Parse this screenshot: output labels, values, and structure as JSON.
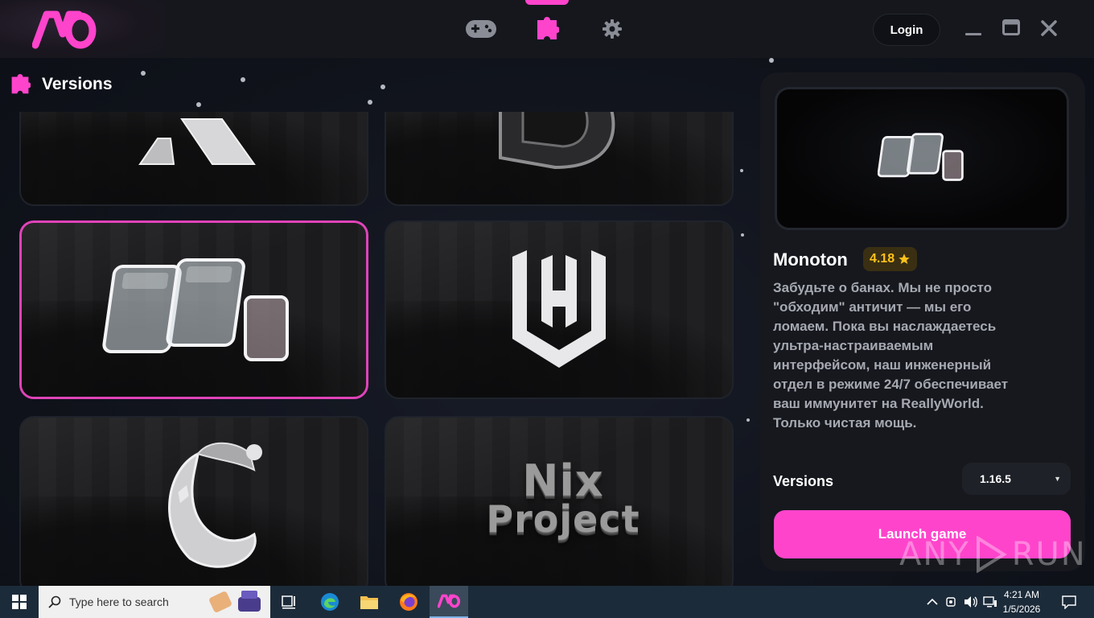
{
  "app": {
    "nav": {
      "games_icon": "gamepad-icon",
      "versions_icon": "puzzle-icon",
      "settings_icon": "gear-icon"
    },
    "login_label": "Login",
    "accent_color": "#ff44cc",
    "section_title": "Versions"
  },
  "cards": [
    {
      "name": "card-partial-left-logo"
    },
    {
      "name": "card-partial-right-logo"
    },
    {
      "name": "card-monoton",
      "selected": true
    },
    {
      "name": "card-lw-logo"
    },
    {
      "name": "card-moon-logo"
    },
    {
      "name": "card-nix-project",
      "logo_line1": "Nix",
      "logo_line2": "Project"
    }
  ],
  "details": {
    "name": "Monoton",
    "rating": "4.18",
    "description": "Забудьте о банах. Мы не просто \"обходим\" античит — мы его ломаем. Пока вы наслаждаетесь ультра-настраиваемым интерфейсом, наш инженерный отдел в режиме 24/7 обеспечивает ваш иммунитет на ReallyWorld. Только чистая мощь.",
    "versions_label": "Versions",
    "selected_version": "1.16.5",
    "launch_label": "Launch game",
    "rating_color": "#ffc21a"
  },
  "watermark": {
    "text_left": "ANY",
    "text_right": "RUN"
  },
  "taskbar": {
    "search_placeholder": "Type here to search",
    "time": "4:21 AM",
    "date": "1/5/2026"
  }
}
